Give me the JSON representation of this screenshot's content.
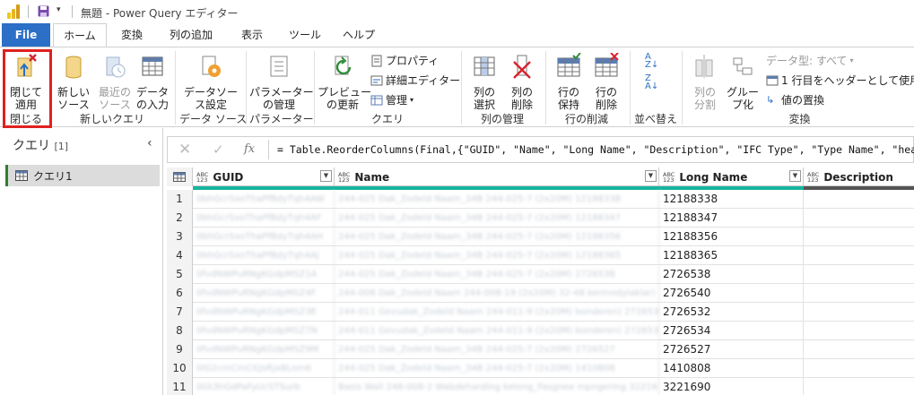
{
  "titlebar": {
    "title": "無題 - Power Query エディター"
  },
  "tabs": [
    "File",
    "ホーム",
    "変換",
    "列の追加",
    "表示",
    "ツール",
    "ヘルプ"
  ],
  "ribbon": {
    "close_apply": "閉じて\n適用",
    "new_source": "新しい\nソース",
    "recent_source": "最近の\nソース",
    "enter_data": "データ\nの入力",
    "datasource_settings": "データソー\nス設定",
    "manage_params": "パラメーター\nの管理",
    "refresh_preview": "プレビュー\nの更新",
    "properties": "プロパティ",
    "advanced_editor": "詳細エディター",
    "manage": "管理",
    "choose_columns": "列の\n選択",
    "remove_columns": "列の\n削除",
    "keep_rows": "行の\n保持",
    "remove_rows": "行の\n削除",
    "sort": "並べ替え",
    "split_column": "列の\n分割",
    "group_by": "グルー\nプ化",
    "data_type": "データ型: すべて",
    "first_row_header": "1 行目をヘッダーとして使用",
    "replace_values": "値の置換",
    "groups": {
      "close": "閉じる",
      "new_query": "新しいクエリ",
      "data_sources": "データ ソース",
      "parameters": "パラメーター",
      "query": "クエリ",
      "manage_columns": "列の管理",
      "reduce_rows": "行の削減",
      "sort": "並べ替え",
      "transform": "変換"
    }
  },
  "queries": {
    "title": "クエリ",
    "count": "[1]",
    "items": [
      "クエリ1"
    ]
  },
  "formula": {
    "text": "= Table.ReorderColumns(Final,{\"GUID\", \"Name\", \"Long Name\", \"Description\", \"IFC Type\", \"Type Name\", \"header\","
  },
  "grid": {
    "type_icon": "ABC\n123",
    "columns": [
      "GUID",
      "Name",
      "Long Name",
      "Description"
    ],
    "rows": [
      {
        "n": "1",
        "guid": "0bhGcrSxoThaPfBdyTqh4AW",
        "name": "244-025 Dak_Zodeld Naam_34B 244-025-7 (2x20M) 12188338",
        "long": "12188338"
      },
      {
        "n": "2",
        "guid": "0bhGcrSxoThaPfBdyTqh4AF",
        "name": "244-025 Dak_Zodeld Naam_34B 244-025-7 (2x20M) 12188347",
        "long": "12188347"
      },
      {
        "n": "3",
        "guid": "0bhGcrSxoThaPfBdyTqh4AH",
        "name": "244-025 Dak_Zodeld Naam_34B 244-025-7 (2x20M) 12188356",
        "long": "12188356"
      },
      {
        "n": "4",
        "guid": "0bhGcrSxoThaPfBdyTqh4AJ",
        "name": "244-025 Dak_Zodeld Naam_34B 244-025-7 (2x20M) 12188365",
        "long": "12188365"
      },
      {
        "n": "5",
        "guid": "0fvdNWPuRNgKGdpMSZ1A",
        "name": "244-025 Dak_Zodeld Naam_34B 244-025-7 (2x20M) 2726538",
        "long": "2726538"
      },
      {
        "n": "6",
        "guid": "0fvdNWPuRNgKGdpMSZ4F",
        "name": "244-008 Dak_Zodeld Naam 244-008-19 (2x20M) 32-48 kermodylaklar) 2726540",
        "long": "2726540"
      },
      {
        "n": "7",
        "guid": "0fvdNWPuRNgKGdpMSZ3E",
        "name": "244-011 Gevudak_Zodeld Naam 244-011-9 (2x20M) bonderen) 2726532",
        "long": "2726532"
      },
      {
        "n": "8",
        "guid": "0fvdNWPuRNgKGdpMSZ7N",
        "name": "244-011 Gevudak_Zodeld Naam 244-011-9 (2x20M) bonderen) 2726534",
        "long": "2726534"
      },
      {
        "n": "9",
        "guid": "0fvdNWPuRNgKGdpMSZ9M",
        "name": "244-025 Dak_Zodeld Naam_34B 244-025-7 (2x20M) 2726527",
        "long": "2726527"
      },
      {
        "n": "10",
        "guid": "0lG2cmCmClQsRjxBLom6",
        "name": "244-025 Dak_Zodeld Naam_34B 244-025-7 (2x20M) 1410808",
        "long": "1410808"
      },
      {
        "n": "11",
        "guid": "0Gt3hGdPaFyUcSTSurb",
        "name": "Basis Wall 246-008-2 Wabdeharding kelong_Fasgnee mpngering 3221690",
        "long": "3221690"
      }
    ]
  },
  "colors": {
    "file_tab": "#2b6fc7",
    "quality": "#18b59f",
    "highlight": "#e02020",
    "query_accent": "#2f7d32"
  }
}
